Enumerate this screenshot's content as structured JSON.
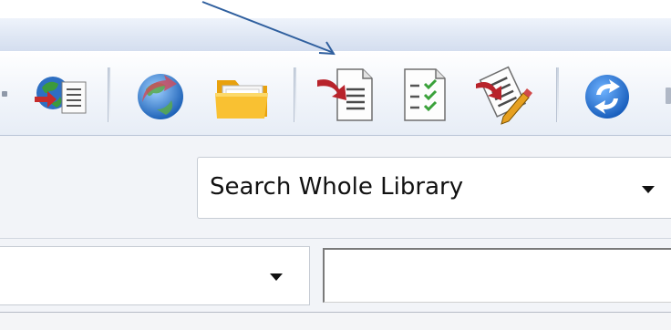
{
  "toolbar": {
    "buttons": [
      {
        "name": "online-search-icon"
      },
      {
        "name": "globe-sync-icon"
      },
      {
        "name": "open-folder-icon"
      },
      {
        "name": "export-document-icon"
      },
      {
        "name": "checklist-icon"
      },
      {
        "name": "edit-document-icon"
      },
      {
        "name": "sync-icon"
      }
    ]
  },
  "search": {
    "scope_value": "Search Whole Library"
  },
  "field_search": {
    "field_value": "",
    "text_value": ""
  }
}
